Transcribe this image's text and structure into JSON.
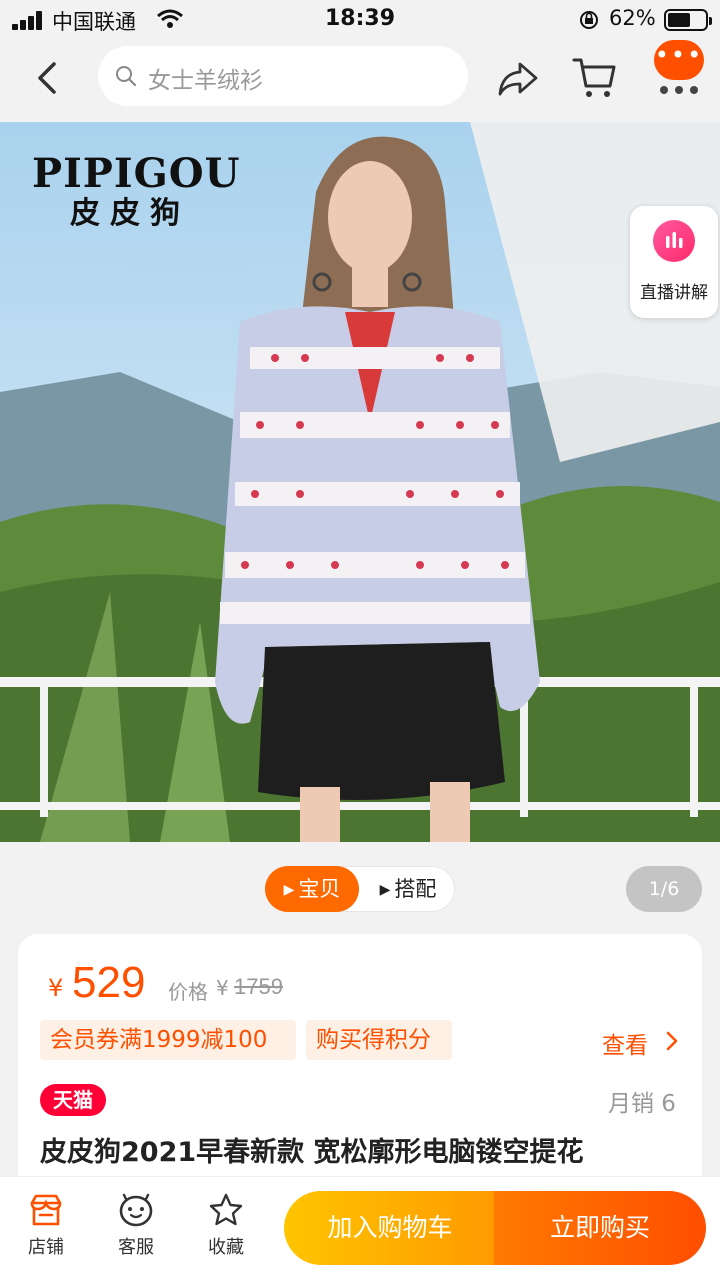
{
  "status_bar": {
    "carrier": "中国联通",
    "time": "18:39",
    "battery_percent": "62%",
    "battery_level": 0.62
  },
  "nav": {
    "search_placeholder": "女士羊绒衫",
    "icons": [
      "back-arrow-icon",
      "search-icon",
      "share-icon",
      "cart-icon",
      "more-icon"
    ]
  },
  "hero": {
    "brand_en": "PIPIGOU",
    "brand_cn": "皮皮狗",
    "live_label": "直播讲解"
  },
  "media_tabs": {
    "active": "宝贝",
    "inactive": "搭配",
    "pager": "1/6"
  },
  "product": {
    "price_symbol": "¥",
    "price": "529",
    "orig_label": "价格",
    "orig_symbol": "¥",
    "orig_price": "1759",
    "coupons": [
      "会员券满1999减100",
      "购买得积分"
    ],
    "view_link": "查看",
    "store_badge": "天猫",
    "sales": "月销 6",
    "title": "皮皮狗2021早春新款 宽松廓形电脑镂空提花"
  },
  "bottom_bar": {
    "shop": "店铺",
    "service": "客服",
    "favorite": "收藏",
    "add_to_cart": "加入购物车",
    "buy_now": "立即购买"
  },
  "colors": {
    "accent": "#ff5000",
    "cart_button": "#ffa800",
    "buy_button": "#ff5a00",
    "tmall": "#ff0036"
  }
}
